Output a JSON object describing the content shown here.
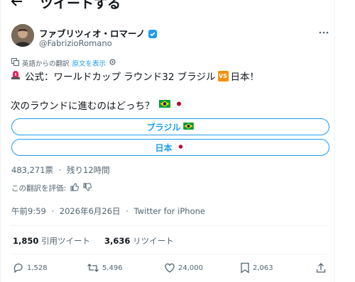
{
  "header": {
    "title": "ツイートする"
  },
  "author": {
    "display_name": "ファブリツィオ・ロマーノ",
    "handle": "@FabrizioRomano"
  },
  "translation": {
    "label": "英語からの翻訳",
    "show_original": "原文を表示"
  },
  "tweet": {
    "line1_text": "公式：ワールドカップ ラウンド32 ブラジル",
    "vs_label": "VS",
    "line1_end": "日本！",
    "line2_text": "次のラウンドに進むのはどっち？"
  },
  "poll": {
    "options": [
      {
        "label": "ブラジル"
      },
      {
        "label": "日本"
      }
    ],
    "votes": "483,271票",
    "separator": "·",
    "remaining": "残り12時間"
  },
  "rate_translation": "この翻訳を評価:",
  "timestamp": {
    "time": "午前9:59",
    "date": "2026年6月26日",
    "separator": "·",
    "source": "Twitter for iPhone"
  },
  "stats": {
    "quote_count": "1,850",
    "quote_label": "引用ツイート",
    "retweet_count": "3,636",
    "retweet_label": "リツイート"
  },
  "actions": {
    "reply_count": "1,528",
    "retweet_count": "5,496",
    "like_count": "24,000",
    "bookmark_count": "2,063"
  },
  "colors": {
    "accent": "#1d9bf0",
    "secondary_text": "#536471",
    "divider": "#eff3f4"
  }
}
